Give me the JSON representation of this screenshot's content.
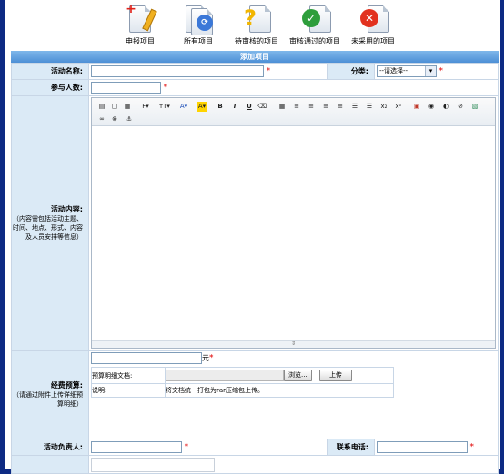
{
  "toolbar": {
    "items": [
      {
        "label": "申报项目",
        "icon": "pencil-doc-icon"
      },
      {
        "label": "所有项目",
        "icon": "docs-icon"
      },
      {
        "label": "待审核的项目",
        "icon": "question-doc-icon"
      },
      {
        "label": "审核通过的项目",
        "icon": "check-doc-icon"
      },
      {
        "label": "未采用的项目",
        "icon": "reject-doc-icon"
      }
    ]
  },
  "section_title": "添加项目",
  "form": {
    "activity_name_label": "活动名称:",
    "category_label": "分类:",
    "category_selected": "--请选择--",
    "participants_label": "参与人数:",
    "content_label": "活动内容:",
    "content_hint": "（内容需包括活动主题、时间、地点、形式、内容及人员安排等信息）",
    "budget_label": "经费预算:",
    "budget_hint": "（请通过附件上传详细预算明细）",
    "budget_unit": "元",
    "budget_doc_label": "预算明细文档:",
    "browse_button": "浏览...",
    "upload_button": "上传",
    "note_label": "说明:",
    "note_text": "将文档统一打包为rar压缩包上传。",
    "leader_label": "活动负责人:",
    "phone_label": "联系电话:",
    "required_mark": "*"
  },
  "editor": {
    "font_button": "F",
    "size_button": "тT",
    "color_button": "A",
    "highlight_button": "A",
    "bold": "B",
    "italic": "I",
    "underline": "U",
    "subscript": "x₂",
    "superscript": "x²"
  }
}
